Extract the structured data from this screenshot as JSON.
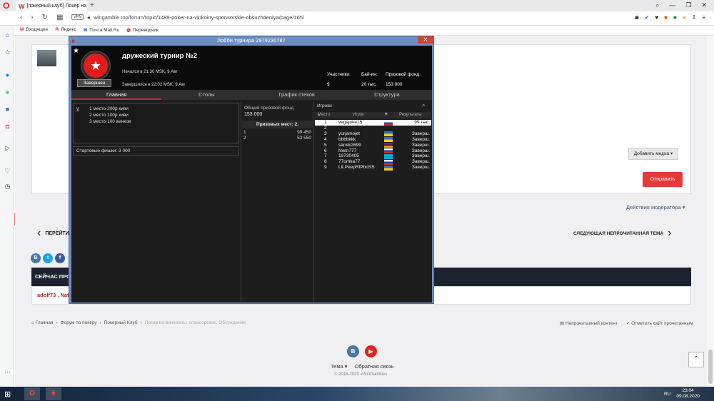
{
  "browser": {
    "tab_title": "[покерный клуб] Покер на",
    "tab_close": "✕",
    "new_tab": "+",
    "url": "wingamble.top/forum/topic/1489-poker-na-vinkoiny-sponsorskie-obsuzhdeniya/page/165/",
    "vpn_badge": "VPN",
    "bookmarks": [
      {
        "icon": "M",
        "label": "Входящие",
        "color": "#d93025"
      },
      {
        "icon": "Я",
        "label": "Яндекс",
        "color": "#e02020"
      },
      {
        "icon": "✉",
        "label": "Почта Mail.Ru",
        "color": "#1a5fd3"
      },
      {
        "icon": "◍",
        "label": "Переводчик",
        "color": "#c22"
      }
    ]
  },
  "forum": {
    "add_media": "Добавить медиа",
    "submit": "Отправить",
    "mod_actions": "Действия модератора",
    "prev_topic": "ПЕРЕЙТИ К",
    "next_topic": "СЛЕДУЮЩАЯ НЕПРОЧИТАННАЯ ТЕМА",
    "now_on_forum": "СЕЙЧАС ПРО",
    "online_users": "adolf73 , Nat",
    "breadcrumbs": [
      "Главная",
      "Форум по покеру",
      "Покерный Клуб"
    ],
    "breadcrumb_current": "Покер на винкоины, спонсорские. Обсуждения",
    "unread": "Непрочитанный контент",
    "mark_read": "Отметить сайт прочитанным",
    "footer_theme": "Тема",
    "footer_feedback": "Обратная связь",
    "copyright": "© 2016-2020 «WinGamble»"
  },
  "lobby": {
    "window_title": "Лобби турнира 2979230787",
    "close": "✕",
    "status": "Завершен",
    "name": "дружеский турнир №2",
    "started": "Начался в 21:30 MSK, 9 Авг",
    "finished": "Завершился в 22:02 MSK, 9 Авг",
    "stats": [
      {
        "label": "Участники:",
        "value": "9"
      },
      {
        "label": "Бай-ин:",
        "value": "20 тыс."
      },
      {
        "label": "Призовой фонд:",
        "value": "153 000"
      }
    ],
    "tabs": [
      "Главная",
      "Столы",
      "График стеков",
      "Структура"
    ],
    "active_tab": 0,
    "prizes_text": [
      "1 место 200р киви",
      "2 место 100р киви",
      "3 место 100 винков"
    ],
    "starting_chips": "Стартовые фишки:  3 000",
    "pool_label": "Общий призовой фонд",
    "pool_value": "153 000",
    "paid_places": "Призовых мест: 2.",
    "payouts": [
      {
        "place": "1",
        "amount": "99 450"
      },
      {
        "place": "2",
        "amount": "53 550"
      }
    ],
    "players_title": "Игроки",
    "col_place": "Место",
    "col_player": "Игрок",
    "col_results": "Результаты",
    "players": [
      {
        "place": "1",
        "name": "vegajoke15",
        "result": "99 тыс.",
        "flag": "ru",
        "selected": true
      },
      {
        "place": "2",
        "name": "",
        "result": "",
        "flag": "none",
        "selected": false
      },
      {
        "place": "3",
        "name": "yurjamojet",
        "result": "Заверш.",
        "flag": "ua",
        "selected": false
      },
      {
        "place": "4",
        "name": "bbbbkkk",
        "result": "Заверш.",
        "flag": "ua",
        "selected": false
      },
      {
        "place": "5",
        "name": "sanek2699",
        "result": "Заверш.",
        "flag": "am",
        "selected": false
      },
      {
        "place": "6",
        "name": "Nwin777",
        "result": "Заверш.",
        "flag": "ru",
        "selected": false
      },
      {
        "place": "7",
        "name": "19730405",
        "result": "Заверш.",
        "flag": "kz",
        "selected": false
      },
      {
        "place": "8",
        "name": "77umka77",
        "result": "Заверш.",
        "flag": "ru",
        "selected": false
      },
      {
        "place": "9",
        "name": "LiLPeepRIPboSS",
        "result": "Заверш.",
        "flag": "ua",
        "selected": false
      }
    ]
  },
  "taskbar": {
    "lang": "RU",
    "time": "23:04",
    "date": "09.08.2020"
  }
}
